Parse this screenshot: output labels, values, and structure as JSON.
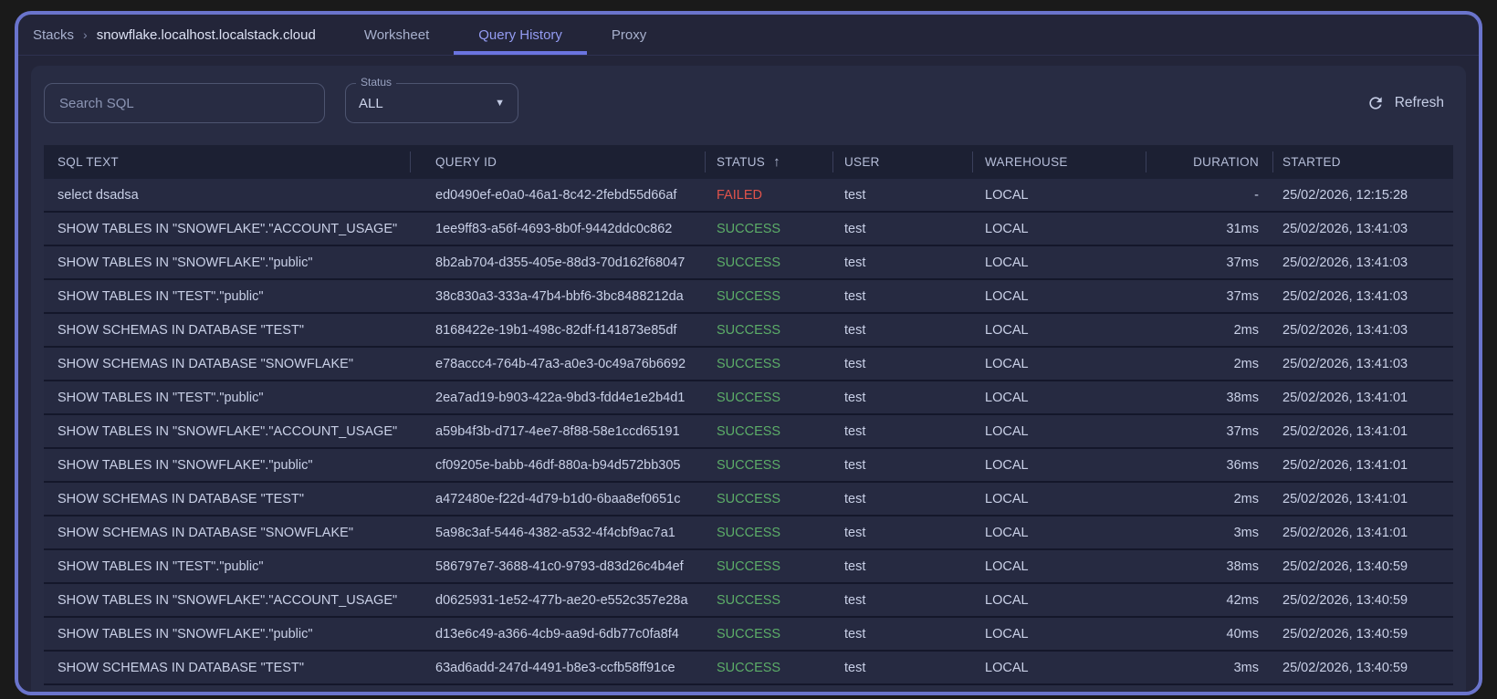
{
  "breadcrumb": {
    "root": "Stacks",
    "separator": "›",
    "current": "snowflake.localhost.localstack.cloud"
  },
  "tabs": [
    {
      "label": "Worksheet",
      "active": false
    },
    {
      "label": "Query History",
      "active": true
    },
    {
      "label": "Proxy",
      "active": false
    }
  ],
  "controls": {
    "search_placeholder": "Search SQL",
    "status_label": "Status",
    "status_value": "ALL",
    "refresh_label": "Refresh"
  },
  "table": {
    "sort_icon": "↑",
    "columns": [
      {
        "key": "sql-text",
        "label": "SQL TEXT"
      },
      {
        "key": "query-id",
        "label": "QUERY ID"
      },
      {
        "key": "status",
        "label": "STATUS",
        "sort": true
      },
      {
        "key": "user",
        "label": "USER"
      },
      {
        "key": "warehouse",
        "label": "WAREHOUSE"
      },
      {
        "key": "duration",
        "label": "DURATION",
        "align": "right"
      },
      {
        "key": "started",
        "label": "STARTED"
      }
    ],
    "rows": [
      {
        "sql_text": "select dsadsa",
        "query_id": "ed0490ef-e0a0-46a1-8c42-2febd55d66af",
        "status": "FAILED",
        "user": "test",
        "warehouse": "LOCAL",
        "duration": "-",
        "started": "25/02/2026, 12:15:28"
      },
      {
        "sql_text": "SHOW TABLES IN \"SNOWFLAKE\".\"ACCOUNT_USAGE\"",
        "query_id": "1ee9ff83-a56f-4693-8b0f-9442ddc0c862",
        "status": "SUCCESS",
        "user": "test",
        "warehouse": "LOCAL",
        "duration": "31ms",
        "started": "25/02/2026, 13:41:03"
      },
      {
        "sql_text": "SHOW TABLES IN \"SNOWFLAKE\".\"public\"",
        "query_id": "8b2ab704-d355-405e-88d3-70d162f68047",
        "status": "SUCCESS",
        "user": "test",
        "warehouse": "LOCAL",
        "duration": "37ms",
        "started": "25/02/2026, 13:41:03"
      },
      {
        "sql_text": "SHOW TABLES IN \"TEST\".\"public\"",
        "query_id": "38c830a3-333a-47b4-bbf6-3bc8488212da",
        "status": "SUCCESS",
        "user": "test",
        "warehouse": "LOCAL",
        "duration": "37ms",
        "started": "25/02/2026, 13:41:03"
      },
      {
        "sql_text": "SHOW SCHEMAS IN DATABASE \"TEST\"",
        "query_id": "8168422e-19b1-498c-82df-f141873e85df",
        "status": "SUCCESS",
        "user": "test",
        "warehouse": "LOCAL",
        "duration": "2ms",
        "started": "25/02/2026, 13:41:03"
      },
      {
        "sql_text": "SHOW SCHEMAS IN DATABASE \"SNOWFLAKE\"",
        "query_id": "e78accc4-764b-47a3-a0e3-0c49a76b6692",
        "status": "SUCCESS",
        "user": "test",
        "warehouse": "LOCAL",
        "duration": "2ms",
        "started": "25/02/2026, 13:41:03"
      },
      {
        "sql_text": "SHOW TABLES IN \"TEST\".\"public\"",
        "query_id": "2ea7ad19-b903-422a-9bd3-fdd4e1e2b4d1",
        "status": "SUCCESS",
        "user": "test",
        "warehouse": "LOCAL",
        "duration": "38ms",
        "started": "25/02/2026, 13:41:01"
      },
      {
        "sql_text": "SHOW TABLES IN \"SNOWFLAKE\".\"ACCOUNT_USAGE\"",
        "query_id": "a59b4f3b-d717-4ee7-8f88-58e1ccd65191",
        "status": "SUCCESS",
        "user": "test",
        "warehouse": "LOCAL",
        "duration": "37ms",
        "started": "25/02/2026, 13:41:01"
      },
      {
        "sql_text": "SHOW TABLES IN \"SNOWFLAKE\".\"public\"",
        "query_id": "cf09205e-babb-46df-880a-b94d572bb305",
        "status": "SUCCESS",
        "user": "test",
        "warehouse": "LOCAL",
        "duration": "36ms",
        "started": "25/02/2026, 13:41:01"
      },
      {
        "sql_text": "SHOW SCHEMAS IN DATABASE \"TEST\"",
        "query_id": "a472480e-f22d-4d79-b1d0-6baa8ef0651c",
        "status": "SUCCESS",
        "user": "test",
        "warehouse": "LOCAL",
        "duration": "2ms",
        "started": "25/02/2026, 13:41:01"
      },
      {
        "sql_text": "SHOW SCHEMAS IN DATABASE \"SNOWFLAKE\"",
        "query_id": "5a98c3af-5446-4382-a532-4f4cbf9ac7a1",
        "status": "SUCCESS",
        "user": "test",
        "warehouse": "LOCAL",
        "duration": "3ms",
        "started": "25/02/2026, 13:41:01"
      },
      {
        "sql_text": "SHOW TABLES IN \"TEST\".\"public\"",
        "query_id": "586797e7-3688-41c0-9793-d83d26c4b4ef",
        "status": "SUCCESS",
        "user": "test",
        "warehouse": "LOCAL",
        "duration": "38ms",
        "started": "25/02/2026, 13:40:59"
      },
      {
        "sql_text": "SHOW TABLES IN \"SNOWFLAKE\".\"ACCOUNT_USAGE\"",
        "query_id": "d0625931-1e52-477b-ae20-e552c357e28a",
        "status": "SUCCESS",
        "user": "test",
        "warehouse": "LOCAL",
        "duration": "42ms",
        "started": "25/02/2026, 13:40:59"
      },
      {
        "sql_text": "SHOW TABLES IN \"SNOWFLAKE\".\"public\"",
        "query_id": "d13e6c49-a366-4cb9-aa9d-6db77c0fa8f4",
        "status": "SUCCESS",
        "user": "test",
        "warehouse": "LOCAL",
        "duration": "40ms",
        "started": "25/02/2026, 13:40:59"
      },
      {
        "sql_text": "SHOW SCHEMAS IN DATABASE \"TEST\"",
        "query_id": "63ad6add-247d-4491-b8e3-ccfb58ff91ce",
        "status": "SUCCESS",
        "user": "test",
        "warehouse": "LOCAL",
        "duration": "3ms",
        "started": "25/02/2026, 13:40:59"
      }
    ]
  },
  "colors": {
    "window_border": "#6a74cc",
    "window_background": "#232539",
    "panel_background": "#282c43",
    "table_header_background": "#1c2033",
    "row_background": "#262a41",
    "active_tab": "#949cf3",
    "tab_underline": "#6a74e0",
    "status_success": "#5cad68",
    "status_failed": "#e1534b"
  }
}
